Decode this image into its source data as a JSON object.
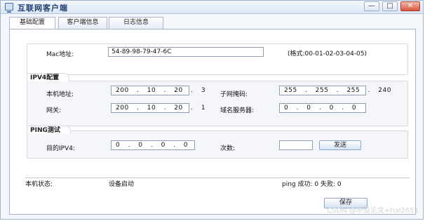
{
  "window": {
    "title": "互联网客户端",
    "controls": {
      "minimize": "—",
      "maximize": "□",
      "close": "✕"
    }
  },
  "tabs": [
    {
      "label": "基础配置"
    },
    {
      "label": "客户端信息"
    },
    {
      "label": "日志信息"
    }
  ],
  "mac": {
    "label": "Mac地址:",
    "value": "54-89-98-79-47-6C",
    "hint": "(格式:00-01-02-03-04-05)"
  },
  "ipv4": {
    "legend": "IPV4配置",
    "host_label": "本机地址:",
    "host_value": "200 . 10 . 20 . 3",
    "mask_label": "子网掩码:",
    "mask_value": "255 . 255 . 255 . 240",
    "gateway_label": "网关:",
    "gateway_value": "200 . 10 . 20 . 1",
    "dns_label": "域名服务器:",
    "dns_value": "0 . 0 . 0 . 0"
  },
  "ping": {
    "legend": "PING测试",
    "target_label": "目的IPV4:",
    "target_value": "0 . 0 . 0 . 0",
    "count_label": "次数:",
    "count_value": "",
    "send_label": "发送"
  },
  "status": {
    "label": "本机状态:",
    "value": "设备启动",
    "ping_result": "ping 成功: 0 失败: 0"
  },
  "save_label": "保存",
  "watermark": "CSDN @毕设论文+hal2651"
}
